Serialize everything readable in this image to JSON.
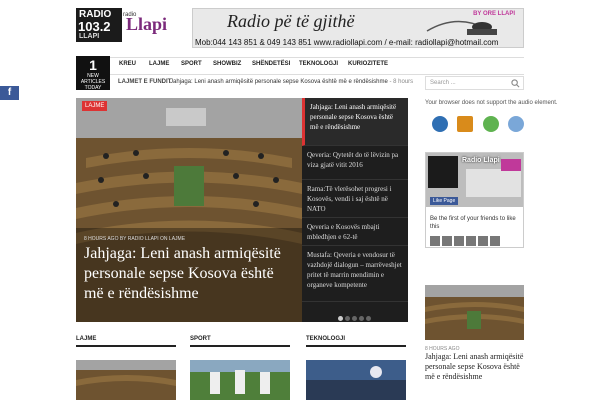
{
  "logo": {
    "line1": "RADIO",
    "line2": "103.2",
    "line3": "LLAPI",
    "name": "Llapi",
    "vertical": "radio"
  },
  "banner": {
    "slogan": "Radio pë të gjithë",
    "contact": "Mob:044 143 851 & 049 143 851  www.radiollapi.com  / e-mail:  radiollapi@hotmail.com",
    "by": "BY ORE LLAPI"
  },
  "counter": {
    "value": "1",
    "label": "NEW ARTICLES TODAY"
  },
  "nav": {
    "items": [
      "KREU",
      "LAJME",
      "SPORT",
      "SHOWBIZ",
      "SHËNDETËSI",
      "TEKNOLOGJI",
      "KURIOZITETE"
    ]
  },
  "search": {
    "placeholder": "Search ..."
  },
  "ticker": {
    "label": "LAJMET E FUNDIT",
    "text": "Jahjaga: Leni anash armiqësitë personale sepse Kosova është më e rëndësishme",
    "time": " - 8 hours"
  },
  "slider": {
    "category": "LAJME",
    "meta": "8 HOURS AGO BY RADIO LLAPI ON LAJME",
    "title": "Jahjaga: Leni anash armiqësitë personale sepse Kosova është më e rëndësishme",
    "side": [
      "Jahjaga: Leni anash armiqësitë personale sepse Kosova është më e rëndësishme",
      "Qeveria: Qytetët do të lëvizin pa viza gjatë vitit 2016",
      "Rama:Të vlerësohet progresi i Kosovës, vendi i saj është në NATO",
      "Qeveria e Kosovës mbajti mbledhjen e 62-të",
      "Mustafa: Qeveria e vendosur të vazhdojë dialogun – marrëveshjet pritet të marrin mendimin e organeve kompetente"
    ],
    "active_dot": 1,
    "dot_count": 5
  },
  "sidebar": {
    "audio_msg": "Your browser does not support the audio element.",
    "player_icons": [
      "player-play-icon",
      "player-winamp-icon",
      "player-music-icon",
      "player-chat-icon"
    ],
    "fb": {
      "name": "Radio Llapi",
      "like": "Like Page",
      "msg": "Be the first of your friends to like this"
    },
    "post": {
      "time": "8 HOURS AGO",
      "title": "Jahjaga: Leni anash armiqësitë personale sepse Kosova është më e rëndësishme"
    }
  },
  "sections": [
    "LAJME",
    "SPORT",
    "TEKNOLOGJI"
  ],
  "colors": {
    "accent": "#dd3333",
    "facebook": "#3b5998",
    "dark": "#111111"
  },
  "fb_float": "f"
}
